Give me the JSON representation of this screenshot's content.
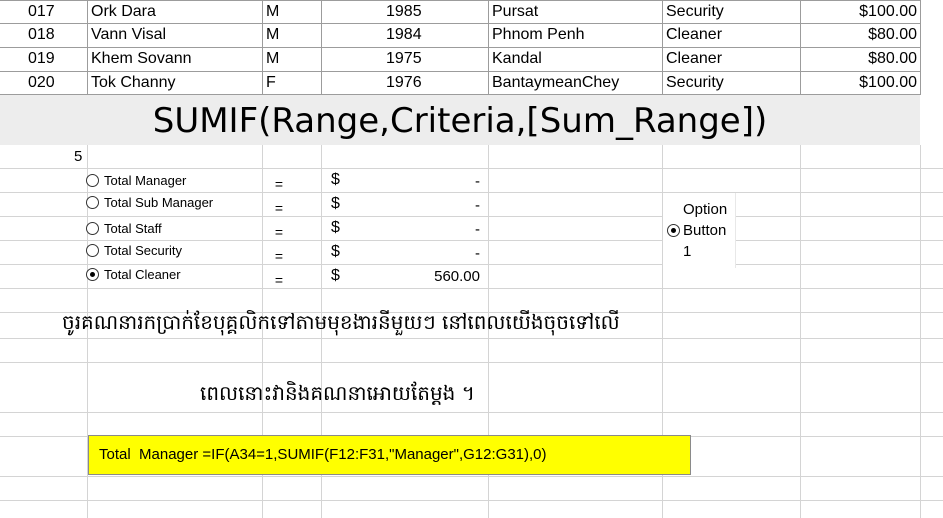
{
  "rows": [
    {
      "id": "017",
      "name": "Ork Dara",
      "gender": "M",
      "year": "1985",
      "place": "Pursat",
      "role": "Security",
      "salary": "$100.00"
    },
    {
      "id": "018",
      "name": "Vann Visal",
      "gender": "M",
      "year": "1984",
      "place": "Phnom Penh",
      "role": "Cleaner",
      "salary": "$80.00"
    },
    {
      "id": "019",
      "name": "Khem Sovann",
      "gender": "M",
      "year": "1975",
      "place": "Kandal",
      "role": "Cleaner",
      "salary": "$80.00"
    },
    {
      "id": "020",
      "name": "Tok Channy",
      "gender": "F",
      "year": "1976",
      "place": "BantaymeanChey",
      "role": "Security",
      "salary": "$100.00"
    }
  ],
  "title": "SUMIF(Range,Criteria,[Sum_Range])",
  "linked_cell_value": "5",
  "options": [
    {
      "label": "Total Manager",
      "equals": "=",
      "currency": "$",
      "amount": "-",
      "selected": false
    },
    {
      "label": "Total Sub Manager",
      "equals": "=",
      "currency": "$",
      "amount": "-",
      "selected": false
    },
    {
      "label": "Total Staff",
      "equals": "=",
      "currency": "$",
      "amount": "-",
      "selected": false
    },
    {
      "label": "Total Security",
      "equals": "=",
      "currency": "$",
      "amount": "-",
      "selected": false
    },
    {
      "label": "Total Cleaner",
      "equals": "=",
      "currency": "$",
      "amount": "560.00",
      "selected": true
    }
  ],
  "option_button": {
    "label": "OptionButton1",
    "selected": true
  },
  "instructions": [
    "ចូរគណនារកប្រាក់ខែបុគ្គលិកទៅតាមមុខងារនីមួយៗ នៅពេលយើងចុចទៅលើ",
    "ពេលនោះវានិងគណនាអោយតែម្តង ។"
  ],
  "formula_note": "Total  Manager =IF(A34=1,SUMIF(F12:F31,\"Manager\",G12:G31),0)",
  "colors": {
    "highlight": "#ffff00",
    "title_band": "#ededed",
    "gridline": "#d4d4d4"
  }
}
